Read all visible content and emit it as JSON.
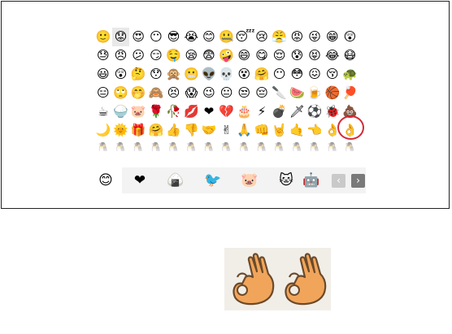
{
  "emoji_panel": {
    "rows": [
      [
        "🙂",
        "😟",
        "😍",
        "😶",
        "😎",
        "😭",
        "😊",
        "🤐",
        "😴",
        "😢",
        "😤",
        "😡",
        "😜",
        "😁",
        "😲"
      ],
      [
        "😓",
        "😠",
        "😕",
        "😏",
        "🤤",
        "😪",
        "😨",
        "🤪",
        "😄",
        "😋",
        "😌",
        "😰",
        "😝",
        "😂",
        "😷"
      ],
      [
        "😃",
        "😲",
        "🤔",
        "😯",
        "🙊",
        "😬",
        "👽",
        "💀",
        "😵",
        "🤗",
        "😶",
        "😳",
        "😖",
        "😚",
        "🐢"
      ],
      [
        "😑",
        "🙄",
        "🤭",
        "🙈",
        "😣",
        "😱",
        "😉",
        "😐",
        "😒",
        "😔",
        "🔪",
        "🍉",
        "🍺",
        "🏀",
        "🏓"
      ],
      [
        "☕",
        "🍚",
        "🐷",
        "🌹",
        "🥀",
        "💋",
        "❤",
        "💔",
        "🎂",
        "⚡",
        "💣",
        "🗡",
        "⚽",
        "🐞",
        "💩"
      ],
      [
        "🌙",
        "🌞",
        "🎁",
        "🤗",
        "👍",
        "👎",
        "🤝",
        "✌",
        "🙏",
        "👊",
        "🤘",
        "🤙",
        "👈",
        "👌",
        "👌"
      ],
      [
        "🐧",
        "🐧",
        "🐧",
        "🐧",
        "🐧",
        "🐧",
        "🐧",
        "🐧",
        "🐧",
        "🐧",
        "🐧",
        "🐧",
        "🐧",
        "🐧",
        "🐧"
      ],
      [
        "🐧",
        "🐧",
        "🐧",
        "🐧",
        "🐧",
        "🐧",
        "🐧",
        "🐧",
        "🐧",
        "🐧",
        "🐧",
        "🐧",
        "🐧",
        "🐧",
        "🐧"
      ]
    ],
    "highlighted_emoji": "👌"
  },
  "tabs": [
    {
      "icon": "default-smiley-icon",
      "glyph": "😊",
      "active": true
    },
    {
      "icon": "heart-icon",
      "glyph": "❤",
      "active": false
    },
    {
      "icon": "sticker-bun-icon",
      "glyph": "🍙",
      "active": false
    },
    {
      "icon": "sticker-bird-icon",
      "glyph": "🐦",
      "active": false
    },
    {
      "icon": "sticker-pig-icon",
      "glyph": "🐷",
      "active": false
    },
    {
      "icon": "sticker-cat-icon",
      "glyph": "🐱",
      "active": false
    },
    {
      "icon": "sticker-figure-icon",
      "glyph": "🤖",
      "active": false
    }
  ],
  "nav": {
    "prev_glyph": "‹",
    "next_glyph": "›"
  },
  "colors": {
    "highlight_ring": "#d42a36",
    "tab_bar_bg": "#f3f3f3",
    "hand_skin": "#f1a55a",
    "zoom_bg": "#f1eee8"
  },
  "zoom": {
    "hands": [
      "ok-hand-icon",
      "ok-hand-icon"
    ]
  }
}
